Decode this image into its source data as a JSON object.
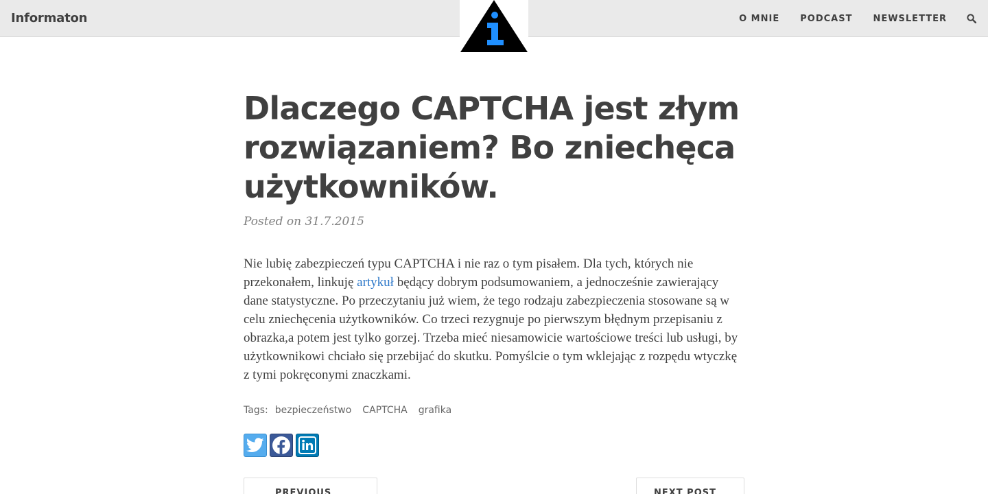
{
  "header": {
    "brand": "Informaton",
    "nav": [
      {
        "label": "O MNIE"
      },
      {
        "label": "PODCAST"
      },
      {
        "label": "NEWSLETTER"
      }
    ],
    "search_icon": "search-icon",
    "logo": "info-triangle-logo"
  },
  "post": {
    "title": "Dlaczego CAPTCHA jest złym rozwiązaniem? Bo zniechęca użytkowników.",
    "meta": "Posted on 31.7.2015",
    "body_before_link": "Nie lubię zabezpieczeń typu CAPTCHA i nie raz o tym pisałem. Dla tych, których nie przekonałem, linkuję ",
    "link_text": "artykuł",
    "body_after_link": " będący dobrym podsumowaniem, a jednocześnie zawierający dane statystyczne. Po przeczytaniu już wiem, że tego rodzaju zabezpieczenia stosowane są w celu zniechęcenia użytkowników. Co trzeci rezygnuje po pierwszym błędnym przepisaniu z obrazka,a potem jest tylko gorzej. Trzeba mieć niesamowicie wartościowe treści lub usługi, by użytkownikowi chciało się przebijać do skutku. Pomyślcie o tym wklejając z rozpędu wtyczkę z tymi pokręconymi znaczkami.",
    "tags_label": "Tags:",
    "tags": [
      "bezpieczeństwo",
      "CAPTCHA",
      "grafika"
    ]
  },
  "share": {
    "twitter_icon": "twitter-icon",
    "facebook_icon": "facebook-icon",
    "linkedin_icon": "linkedin-icon"
  },
  "pager": {
    "prev": "PREVIOUS POST",
    "next": "NEXT POST"
  },
  "colors": {
    "navbar_bg": "#eaeaea",
    "text": "#404040",
    "link": "#2d78c9",
    "logo_blue": "#1f8fff",
    "twitter": "#55acee",
    "facebook": "#3b5998",
    "linkedin": "#007bb5"
  }
}
